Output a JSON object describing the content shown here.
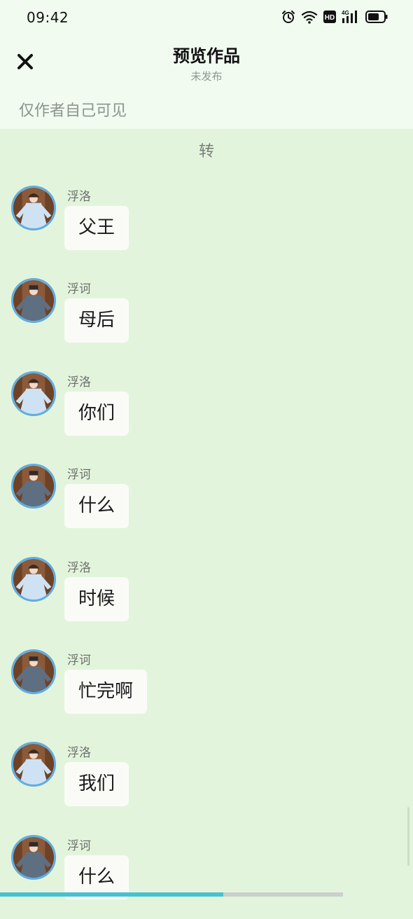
{
  "status_bar": {
    "time": "09:42",
    "icons": [
      "alarm-icon",
      "wifi-icon",
      "hd-icon",
      "signal-4g-icon",
      "battery-icon"
    ]
  },
  "header": {
    "title": "预览作品",
    "subtitle": "未发布",
    "close_icon": "close-icon"
  },
  "visibility_note": "仅作者自己可见",
  "scene_label": "转",
  "characters": {
    "fuluo": {
      "name": "浮洛",
      "robe": "#cfe2f4"
    },
    "fuhe": {
      "name": "浮诃",
      "robe": "#5f6f82"
    }
  },
  "messages": [
    {
      "speaker": "浮洛",
      "avatar": "fuluo",
      "text": "父王"
    },
    {
      "speaker": "浮诃",
      "avatar": "fuhe",
      "text": "母后"
    },
    {
      "speaker": "浮洛",
      "avatar": "fuluo",
      "text": "你们"
    },
    {
      "speaker": "浮诃",
      "avatar": "fuhe",
      "text": "什么"
    },
    {
      "speaker": "浮洛",
      "avatar": "fuluo",
      "text": "时候"
    },
    {
      "speaker": "浮诃",
      "avatar": "fuhe",
      "text": "忙完啊"
    },
    {
      "speaker": "浮洛",
      "avatar": "fuluo",
      "text": "我们"
    },
    {
      "speaker": "浮诃",
      "avatar": "fuhe",
      "text": "什么"
    }
  ],
  "colors": {
    "background": "#e3f4dc",
    "header_background": "#f1fbf0",
    "bubble": "#fafbf7",
    "avatar_ring": "#5eaee2"
  },
  "playback": {
    "played_fraction": 0.54,
    "buffered_fraction": 0.83,
    "colors": {
      "played": "#47c1d2",
      "buffered": "#c9d0cd"
    }
  }
}
